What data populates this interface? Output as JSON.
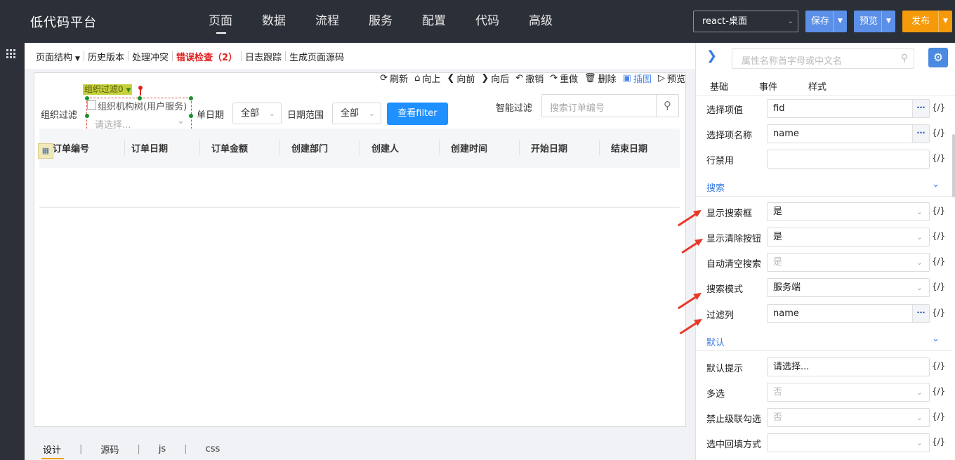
{
  "app": {
    "title": "低代码平台"
  },
  "nav": {
    "items": [
      "页面",
      "数据",
      "流程",
      "服务",
      "配置",
      "代码",
      "高级"
    ]
  },
  "toolbar": {
    "env_value": "react-桌面",
    "save_label": "保存",
    "preview_label": "预览",
    "publish_label": "发布"
  },
  "subbar": {
    "page_structure": "页面结构",
    "history": "历史版本",
    "conflict": "处理冲突",
    "error_check": "错误检查（2）",
    "log": "日志跟踪",
    "gen_source": "生成页面源码"
  },
  "canvas_toolbar": {
    "refresh": "刷新",
    "up": "向上",
    "forward": "向前",
    "backward": "向后",
    "undo": "撤销",
    "redo": "重做",
    "delete": "删除",
    "insert": "插图",
    "preview": "预览"
  },
  "filter": {
    "org_label": "组织过滤",
    "selected_tag": "组织过滤0",
    "tree_label": "组织机构树(用户服务)",
    "tree_placeholder": "请选择...",
    "order_date_label": "单日期",
    "order_date_value": "全部",
    "date_range_label": "日期范围",
    "date_range_value": "全部",
    "query_button": "查看filter",
    "smart_filter_label": "智能过滤",
    "search_placeholder": "搜索订单编号"
  },
  "table": {
    "columns": [
      "订单编号",
      "订单日期",
      "订单金额",
      "创建部门",
      "创建人",
      "创建时间",
      "开始日期",
      "结束日期"
    ]
  },
  "bottom_tabs": [
    "设计",
    "源码",
    "js",
    "css"
  ],
  "panel": {
    "search_placeholder": "属性名称首字母或中文名",
    "tabs": [
      "基础",
      "事件",
      "样式"
    ],
    "rows_basic": [
      {
        "label": "选择项值",
        "value": "fid"
      },
      {
        "label": "选择项名称",
        "value": "name"
      },
      {
        "label": "行禁用",
        "value": ""
      }
    ],
    "section_search": "搜索",
    "rows_search": [
      {
        "label": "显示搜索框",
        "value": "是"
      },
      {
        "label": "显示清除按钮",
        "value": "是"
      },
      {
        "label": "自动清空搜索",
        "value": "是"
      },
      {
        "label": "搜索模式",
        "value": "服务端"
      },
      {
        "label": "过滤列",
        "value": "name"
      }
    ],
    "section_default": "默认",
    "rows_default": [
      {
        "label": "默认提示",
        "value": "请选择..."
      },
      {
        "label": "多选",
        "value": "否"
      },
      {
        "label": "禁止级联勾选",
        "value": "否"
      },
      {
        "label": "选中回填方式",
        "value": ""
      }
    ],
    "fx": "{/}"
  },
  "colors": {
    "primary": "#1e90ff",
    "accent_blue": "#3a7be0",
    "publish": "#f49a0b",
    "error": "#e02020",
    "arrow": "#e8382a"
  }
}
